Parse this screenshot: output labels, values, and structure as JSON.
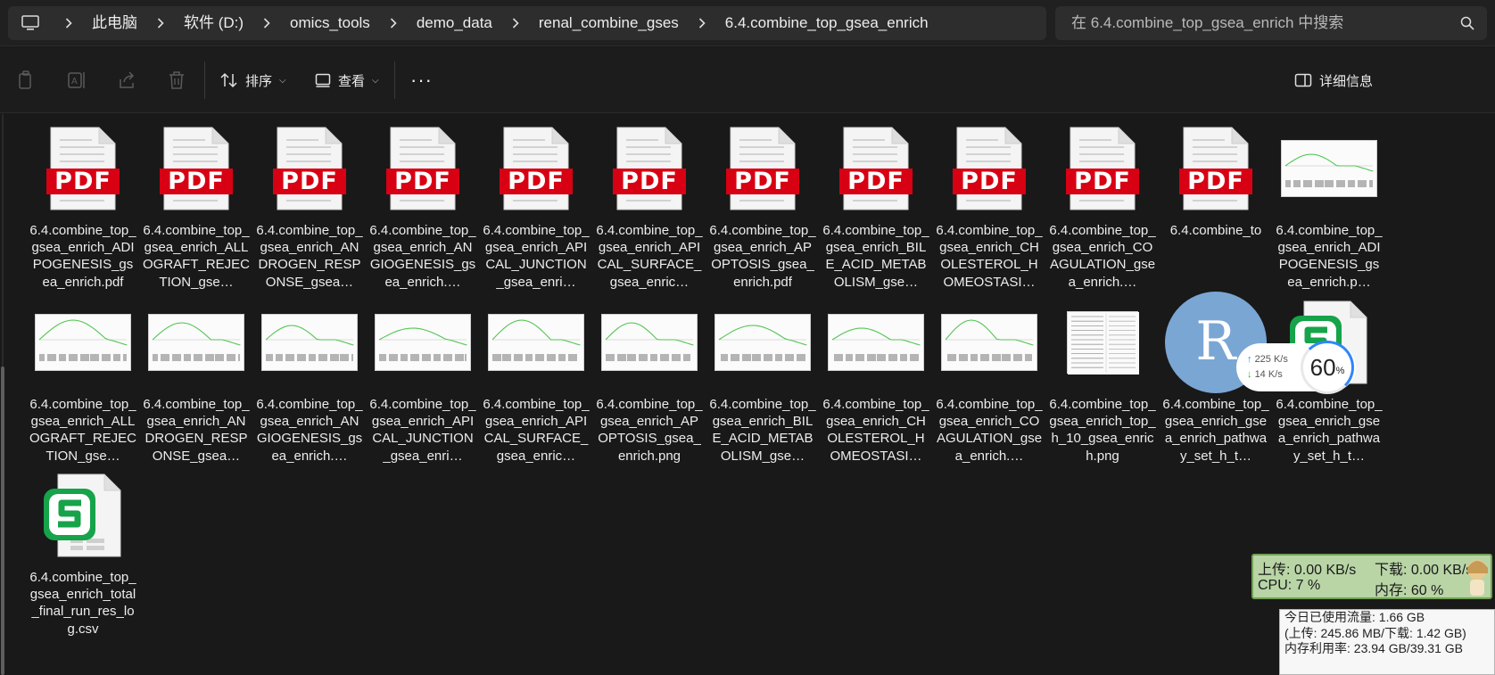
{
  "address": {
    "crumbs": [
      "此电脑",
      "软件 (D:)",
      "omics_tools",
      "demo_data",
      "renal_combine_gses",
      "6.4.combine_top_gsea_enrich"
    ]
  },
  "search": {
    "placeholder": "在 6.4.combine_top_gsea_enrich 中搜索"
  },
  "toolbar": {
    "sort_label": "排序",
    "view_label": "查看",
    "more_label": "···",
    "details_label": "详细信息"
  },
  "files": [
    {
      "name": "6.4.combine_top_gsea_enrich_ADIPOGENESIS_gsea_enrich.pdf",
      "display": "6.4.combine_to p_gsea_enrich_ ADIPOGENESIS_ gsea_enrich.pdf",
      "kind": "pdf"
    },
    {
      "name": "6.4.combine_top_gsea_enrich_ALLOGRAFT_REJECTION_gse…",
      "display": "6.4.combine_to p_gsea_enrich_ ALLOGRAFT_RE JECTION_gse…",
      "kind": "pdf"
    },
    {
      "name": "6.4.combine_top_gsea_enrich_ANDROGEN_RESPONSE_gsea…",
      "display": "6.4.combine_to p_gsea_enrich_ ANDROGEN_RE SPONSE_gsea…",
      "kind": "pdf"
    },
    {
      "name": "6.4.combine_top_gsea_enrich_ANGIOGENESIS_gsea_enrich.…",
      "display": "6.4.combine_to p_gsea_enrich_ ANGIOGENESIS _gsea_enrich.…",
      "kind": "pdf"
    },
    {
      "name": "6.4.combine_top_gsea_enrich_APICAL_JUNCTION_gsea_enri…",
      "display": "6.4.combine_to p_gsea_enrich_ APICAL_JUNCTI ON_gsea_enri…",
      "kind": "pdf"
    },
    {
      "name": "6.4.combine_top_gsea_enrich_APICAL_SURFACE_gsea_enric…",
      "display": "6.4.combine_to p_gsea_enrich_ APICAL_SURFA CE_gsea_enric…",
      "kind": "pdf"
    },
    {
      "name": "6.4.combine_top_gsea_enrich_APOPTOSIS_gsea_enrich.pdf",
      "display": "6.4.combine_to p_gsea_enrich_ APOPTOSIS_gs ea_enrich.pdf",
      "kind": "pdf"
    },
    {
      "name": "6.4.combine_top_gsea_enrich_BILE_ACID_METABOLISM_gse…",
      "display": "6.4.combine_to p_gsea_enrich_ BILE_ACID_MET ABOLISM_gse…",
      "kind": "pdf"
    },
    {
      "name": "6.4.combine_top_gsea_enrich_CHOLESTEROL_HOMEOSTASI…",
      "display": "6.4.combine_to p_gsea_enrich_ CHOLESTEROL_ HOMEOSTASI…",
      "kind": "pdf"
    },
    {
      "name": "6.4.combine_top_gsea_enrich_COAGULATION_gsea_enrich.…",
      "display": "6.4.combine_to p_gsea_enrich_ COAGULATION _gsea_enrich.…",
      "kind": "pdf"
    },
    {
      "name": "6.4.combine_to…",
      "display": "6.4.combine_to",
      "kind": "pdf"
    },
    {
      "name": "6.4.combine_top_gsea_enrich_ADIPOGENESIS_gsea_enrich.p…",
      "display": "6.4.combine_to p_gsea_enrich_ ADIPOGENESIS_ gsea_enrich.p…",
      "kind": "plot"
    },
    {
      "name": "6.4.combine_top_gsea_enrich_ALLOGRAFT_REJECTION_gse…",
      "display": "6.4.combine_to p_gsea_enrich_ ALLOGRAFT_RE JECTION_gse…",
      "kind": "plot"
    },
    {
      "name": "6.4.combine_top_gsea_enrich_ANDROGEN_RESPONSE_gsea…",
      "display": "6.4.combine_to p_gsea_enrich_ ANDROGEN_RE SPONSE_gsea…",
      "kind": "plot"
    },
    {
      "name": "6.4.combine_top_gsea_enrich_ANGIOGENESIS_gsea_enrich.…",
      "display": "6.4.combine_to p_gsea_enrich_ ANGIOGENESIS _gsea_enrich.…",
      "kind": "plot"
    },
    {
      "name": "6.4.combine_top_gsea_enrich_APICAL_JUNCTION_gsea_enri…",
      "display": "6.4.combine_to p_gsea_enrich_ APICAL_JUNCTI ON_gsea_enri…",
      "kind": "plot"
    },
    {
      "name": "6.4.combine_top_gsea_enrich_APICAL_SURFACE_gsea_enric…",
      "display": "6.4.combine_to p_gsea_enrich_ APICAL_SURFA CE_gsea_enric…",
      "kind": "plot"
    },
    {
      "name": "6.4.combine_top_gsea_enrich_APOPTOSIS_gsea_enrich.png",
      "display": "6.4.combine_to p_gsea_enrich_ APOPTOSIS_gs ea_enrich.png",
      "kind": "plot"
    },
    {
      "name": "6.4.combine_top_gsea_enrich_BILE_ACID_METABOLISM_gse…",
      "display": "6.4.combine_to p_gsea_enrich_ BILE_ACID_MET ABOLISM_gse…",
      "kind": "plot"
    },
    {
      "name": "6.4.combine_top_gsea_enrich_CHOLESTEROL_HOMEOSTASI…",
      "display": "6.4.combine_to p_gsea_enrich_ CHOLESTEROL_ HOMEOSTASI…",
      "kind": "plot"
    },
    {
      "name": "6.4.combine_top_gsea_enrich_COAGULATION_gsea_enrich.…",
      "display": "6.4.combine_to p_gsea_enrich_ COAGULATION _gsea_enrich.…",
      "kind": "plot"
    },
    {
      "name": "6.4.combine_top_gsea_enrich_top_h_10_gsea_enrich.png",
      "display": "6.4.combine_to p_gsea_enrich_t op_h_10_gsea_ enrich.png",
      "kind": "table"
    },
    {
      "name": "6.4.combine_top_gsea_enrich_gsea_enrich_pathway_set_h_t…",
      "display": "6.4.combine_to p_gsea_enrich_ gsea_enrich_pa thway_set_h_t…",
      "kind": "r"
    },
    {
      "name": "6.4.combine_top_gsea_enrich_gsea_enrich_pathway_set_h_t…",
      "display": "6.4.combine_to p_gsea_enrich_ gsea_enrich_pa thway_set_h_t…",
      "kind": "sheet"
    },
    {
      "name": "6.4.combine_top_gsea_enrich_total_final_run_res_log.csv",
      "display": "6.4.combine_to p_gsea_enrich_t otal_final_run_r es_log.csv",
      "kind": "sheet"
    }
  ],
  "pdf_badge": "PDF",
  "r_letter": "R",
  "netspeed": {
    "up": "225 K/s",
    "down": "14  K/s",
    "percent": "60",
    "percent_sign": "%"
  },
  "monitor": {
    "upload": "上传: 0.00 KB/s",
    "download": "下载: 0.00 KB/s",
    "cpu": "CPU: 7 %",
    "mem": "内存: 60 %"
  },
  "traffic": {
    "line1": "今日已使用流量: 1.66 GB",
    "line2": " (上传: 245.86 MB/下载: 1.42 GB)",
    "line3": "内存利用率: 23.94 GB/39.31 GB"
  },
  "colors": {
    "pdf_red": "#d80013",
    "r_blue": "#7aa6d4",
    "sheet_green": "#16a34a",
    "gsea_curve": "#53c653",
    "monitor_bg": "#b9d5a6"
  }
}
